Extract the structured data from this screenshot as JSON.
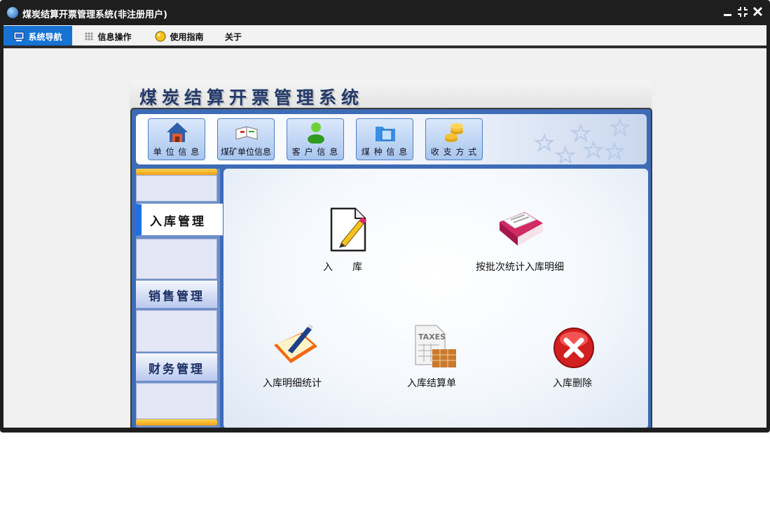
{
  "window": {
    "title": "煤炭结算开票管理系统(非注册用户)"
  },
  "tabs": [
    {
      "label": "系统导航",
      "icon": "monitor-icon"
    },
    {
      "label": "信息操作",
      "icon": "grid-icon"
    },
    {
      "label": "使用指南",
      "icon": "bulb-icon"
    },
    {
      "label": "关于"
    }
  ],
  "banner": {
    "title": "煤炭结算开票管理系统"
  },
  "toolbar": [
    {
      "label": "单 位 信 息",
      "icon": "house-icon"
    },
    {
      "label": "煤矿单位信息",
      "icon": "book-icon"
    },
    {
      "label": "客 户 信 息",
      "icon": "user-icon"
    },
    {
      "label": "煤 种 信 息",
      "icon": "folder-icon"
    },
    {
      "label": "收 支 方 式",
      "icon": "coins-icon"
    }
  ],
  "sidebar": [
    {
      "label": "入库管理",
      "active": true
    },
    {
      "label": "销售管理",
      "active": false
    },
    {
      "label": "财务管理",
      "active": false
    }
  ],
  "main": {
    "items": [
      {
        "label": "入　　库",
        "icon": "edit-document-icon"
      },
      {
        "label": "按批次统计入库明细",
        "icon": "report-book-icon"
      },
      {
        "label": "入库明细统计",
        "icon": "pen-folder-icon"
      },
      {
        "label": "入库结算单",
        "icon": "taxes-icon"
      },
      {
        "label": "入库删除",
        "icon": "delete-icon"
      }
    ]
  },
  "colors": {
    "accent": "#1673d3",
    "frame": "#3d6bb6",
    "title_bar": "#1e1e1e"
  }
}
